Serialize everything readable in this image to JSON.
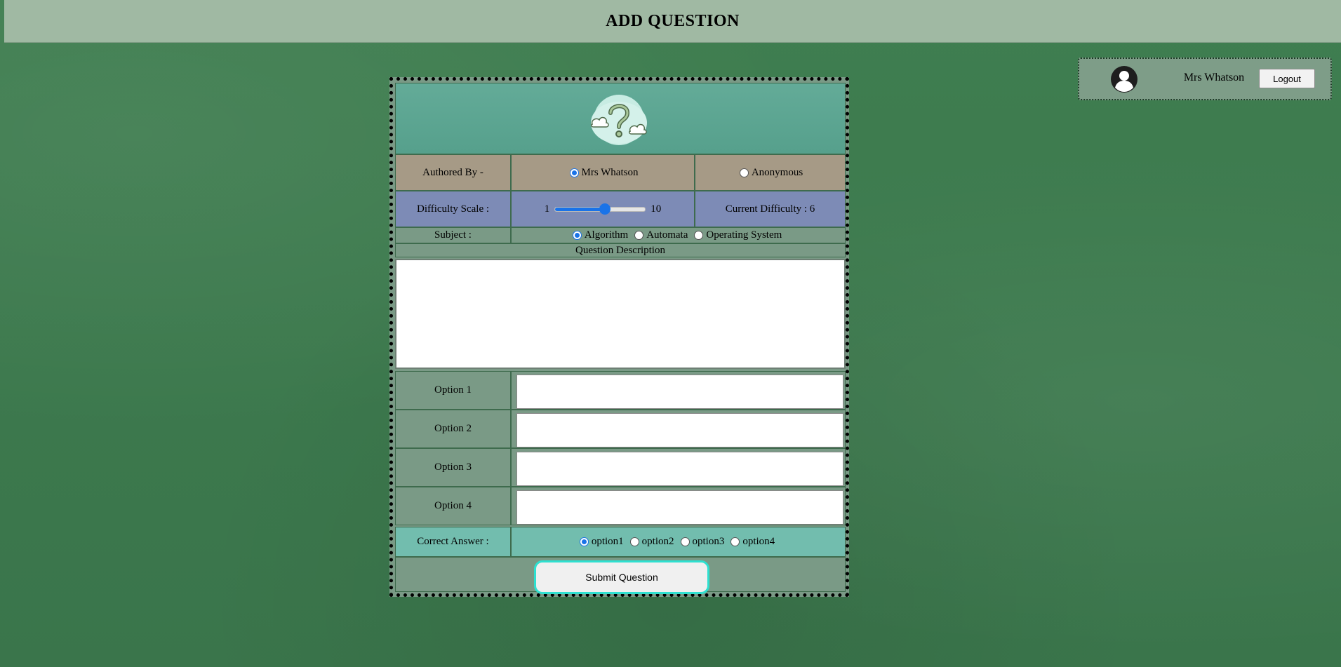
{
  "header": {
    "title": "ADD QUESTION"
  },
  "user": {
    "name": "Mrs Whatson",
    "logout_label": "Logout",
    "avatar_icon": "user-avatar-icon"
  },
  "logo": {
    "icon": "question-cloud-icon"
  },
  "author": {
    "label": "Authored By -",
    "options": [
      {
        "label": "Mrs Whatson",
        "checked": true
      },
      {
        "label": "Anonymous",
        "checked": false
      }
    ]
  },
  "difficulty": {
    "label": "Difficulty Scale :",
    "min_label": "1",
    "max_label": "10",
    "min": 1,
    "max": 10,
    "value": 6,
    "current_label": "Current Difficulty : 6"
  },
  "subject": {
    "label": "Subject :",
    "options": [
      {
        "label": "Algorithm",
        "checked": true
      },
      {
        "label": "Automata",
        "checked": false
      },
      {
        "label": "Operating System",
        "checked": false
      }
    ]
  },
  "question_description": {
    "label": "Question Description",
    "value": ""
  },
  "options": [
    {
      "label": "Option 1",
      "value": ""
    },
    {
      "label": "Option 2",
      "value": ""
    },
    {
      "label": "Option 3",
      "value": ""
    },
    {
      "label": "Option 4",
      "value": ""
    }
  ],
  "correct_answer": {
    "label": "Correct Answer :",
    "options": [
      {
        "label": "option1",
        "checked": true
      },
      {
        "label": "option2",
        "checked": false
      },
      {
        "label": "option3",
        "checked": false
      },
      {
        "label": "option4",
        "checked": false
      }
    ]
  },
  "submit": {
    "label": "Submit Question"
  },
  "colors": {
    "background": "#3d7a4e",
    "header": "#a0b9a3",
    "author_row": "#a69a86",
    "difficulty_row": "#7d8bb6",
    "correct_row": "#72bdae",
    "radio_accent": "#1a73e8",
    "submit_border": "#2ee0d0"
  }
}
